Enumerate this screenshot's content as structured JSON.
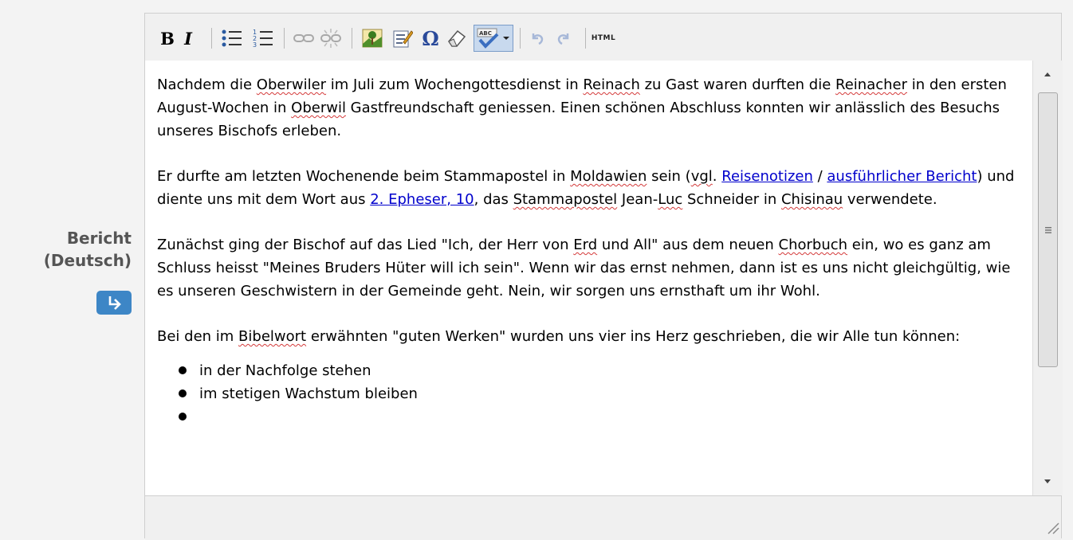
{
  "field": {
    "label_line1": "Bericht",
    "label_line2": "(Deutsch)"
  },
  "toolbar": {
    "bold": "B",
    "italic": "I",
    "html": "HTML"
  },
  "content": {
    "p1": {
      "t1": "Nachdem die ",
      "s1": "Oberwiler",
      "t2": " im Juli zum Wochengottesdienst in ",
      "s2": "Reinach",
      "t3": " zu Gast waren durften die ",
      "s3": "Reinacher",
      "t4": " in den ersten August-Wochen in ",
      "s4": "Oberwil",
      "t5": " Gastfreundschaft geniessen. Einen schönen Abschluss konnten wir anlässlich des Besuchs unseres Bischofs erleben."
    },
    "p2": {
      "t1": "Er durfte am letzten Wochenende beim Stammapostel in ",
      "s1": "Moldawien",
      "t2": " sein (",
      "s2": "vgl",
      "t3": ". ",
      "link1": "Reisenotizen",
      "t4": " / ",
      "link2": "ausführlicher Bericht",
      "t5": ") und diente uns mit dem Wort aus ",
      "link3": "2. Epheser, 10",
      "t6": ", das ",
      "s3": "Stammapostel",
      "t7": " Jean-",
      "s4": "Luc",
      "t8": " Schneider in ",
      "s5": "Chisinau",
      "t9": " verwendete."
    },
    "p3": {
      "t1": "Zunächst ging der Bischof auf das Lied \"Ich, der Herr von ",
      "s1": "Erd",
      "t2": " und All\" aus dem neuen ",
      "s2": "Chorbuch",
      "t3": " ein, wo es ganz am Schluss heisst \"Meines Bruders Hüter will ich sein\". Wenn wir das ernst nehmen, dann ist es uns nicht gleichgültig, wie es unseren Geschwistern in der Gemeinde geht. Nein, wir sorgen uns ernsthaft um ihr Wohl."
    },
    "p4": {
      "t1": "Bei den im ",
      "s1": "Bibelwort",
      "t2": " erwähnten \"guten Werken\" wurden uns vier ins Herz geschrieben, die wir Alle tun können:"
    },
    "list": [
      "in der Nachfolge stehen",
      "im stetigen Wachstum bleiben"
    ]
  }
}
